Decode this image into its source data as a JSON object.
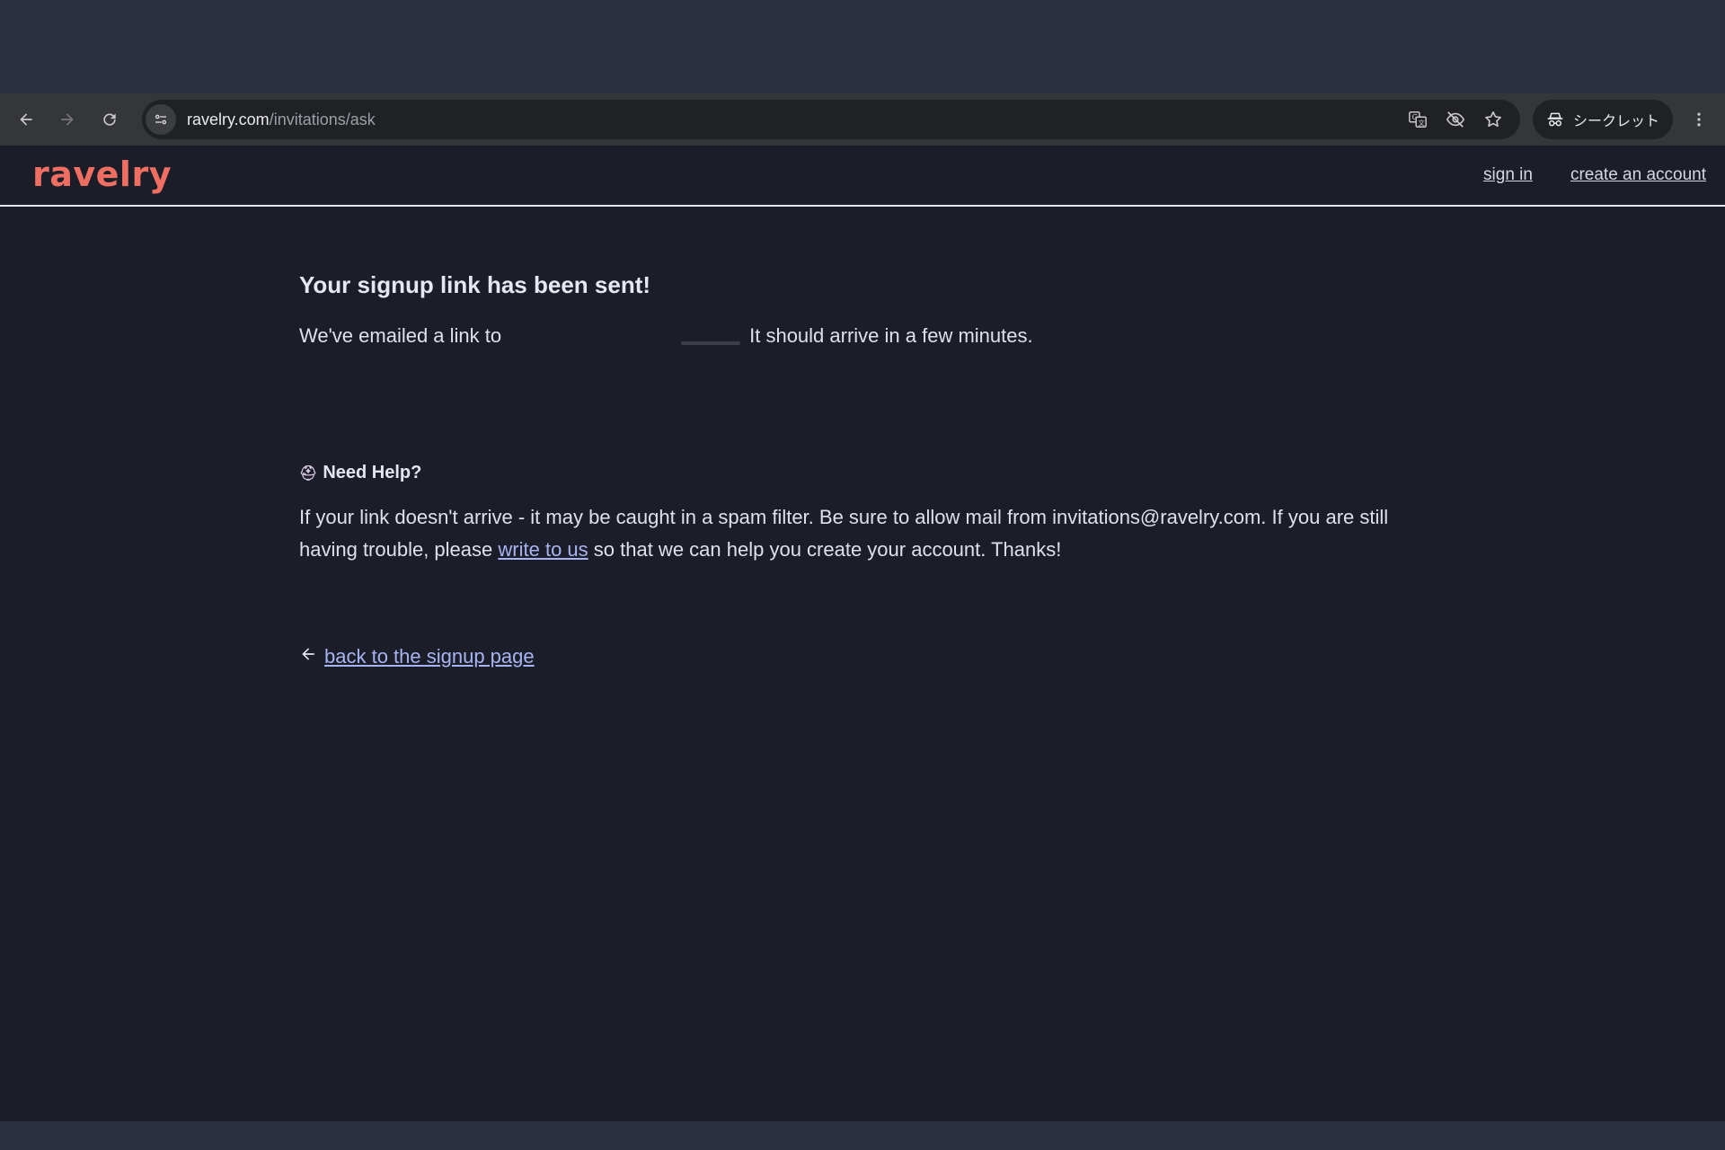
{
  "browser": {
    "url_host": "ravelry.com",
    "url_path": "/invitations/ask",
    "incognito_label": "シークレット",
    "icons": [
      "back-icon",
      "forward-icon",
      "reload-icon",
      "site-info-icon",
      "translate-icon",
      "eye-off-icon",
      "bookmark-star-icon",
      "incognito-icon",
      "more-vert-icon"
    ]
  },
  "header": {
    "logo": "ravelry",
    "sign_in": "sign in",
    "create_account": "create an account"
  },
  "main": {
    "title": "Your signup link has been sent!",
    "sent_prefix": "We've emailed a link to",
    "sent_suffix": "It should arrive in a few minutes.",
    "help_title": "Need Help?",
    "help_text_1": "If your link doesn't arrive - it may be caught in a spam filter. Be sure to allow mail from invitations@ravelry.com. If you are still having trouble, please",
    "help_link": "write to us",
    "help_text_2": "so that we can help you create your account. Thanks!",
    "back_link": "back to the signup page"
  },
  "colors": {
    "logo": "#ee6e62",
    "link": "#a8b4f2",
    "page_bg": "#1b1e29"
  }
}
